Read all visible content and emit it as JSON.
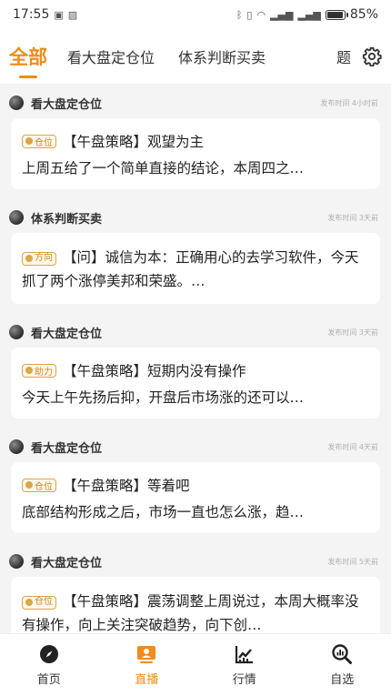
{
  "status_bar": {
    "time": "17:55",
    "battery": "85%",
    "battery_level": 0.85
  },
  "tabs": [
    {
      "label": "全部",
      "active": true
    },
    {
      "label": "看大盘定仓位",
      "active": false
    },
    {
      "label": "体系判断买卖",
      "active": false
    },
    {
      "label": "题",
      "active": false
    }
  ],
  "posts": [
    {
      "author": "看大盘定仓位",
      "time": "发布时间 4小时前",
      "badge": "仓位",
      "title": "【午盘策略】观望为主",
      "text": "上周五给了一个简单直接的结论，本周四之…"
    },
    {
      "author": "体系判断买卖",
      "time": "发布时间 3天前",
      "badge": "方向",
      "title": "【问】诚信为本：正确用心的去学习软件，今天抓了两个涨停美邦和荣盛。…",
      "text": ""
    },
    {
      "author": "看大盘定仓位",
      "time": "发布时间 3天前",
      "badge": "助力",
      "title": "【午盘策略】短期内没有操作",
      "text": " 今天上午先扬后抑，开盘后市场涨的还可以…"
    },
    {
      "author": "看大盘定仓位",
      "time": "发布时间 4天前",
      "badge": "仓位",
      "title": "【午盘策略】等着吧",
      "text": " 底部结构形成之后，市场一直也怎么涨，趋…"
    },
    {
      "author": "看大盘定仓位",
      "time": "发布时间 5天前",
      "badge": "仓位",
      "title": "【午盘策略】震荡调整上周说过，本周大概率没有操作，向上关注突破趋势，向下创…",
      "text": ""
    }
  ],
  "bottom_nav": [
    {
      "label": "首页",
      "icon": "compass-icon",
      "active": false
    },
    {
      "label": "直播",
      "icon": "live-icon",
      "active": true
    },
    {
      "label": "行情",
      "icon": "chart-icon",
      "active": false
    },
    {
      "label": "自选",
      "icon": "search-chart-icon",
      "active": false
    }
  ],
  "colors": {
    "accent": "#f08c1a",
    "badge": "#d9a64a"
  }
}
